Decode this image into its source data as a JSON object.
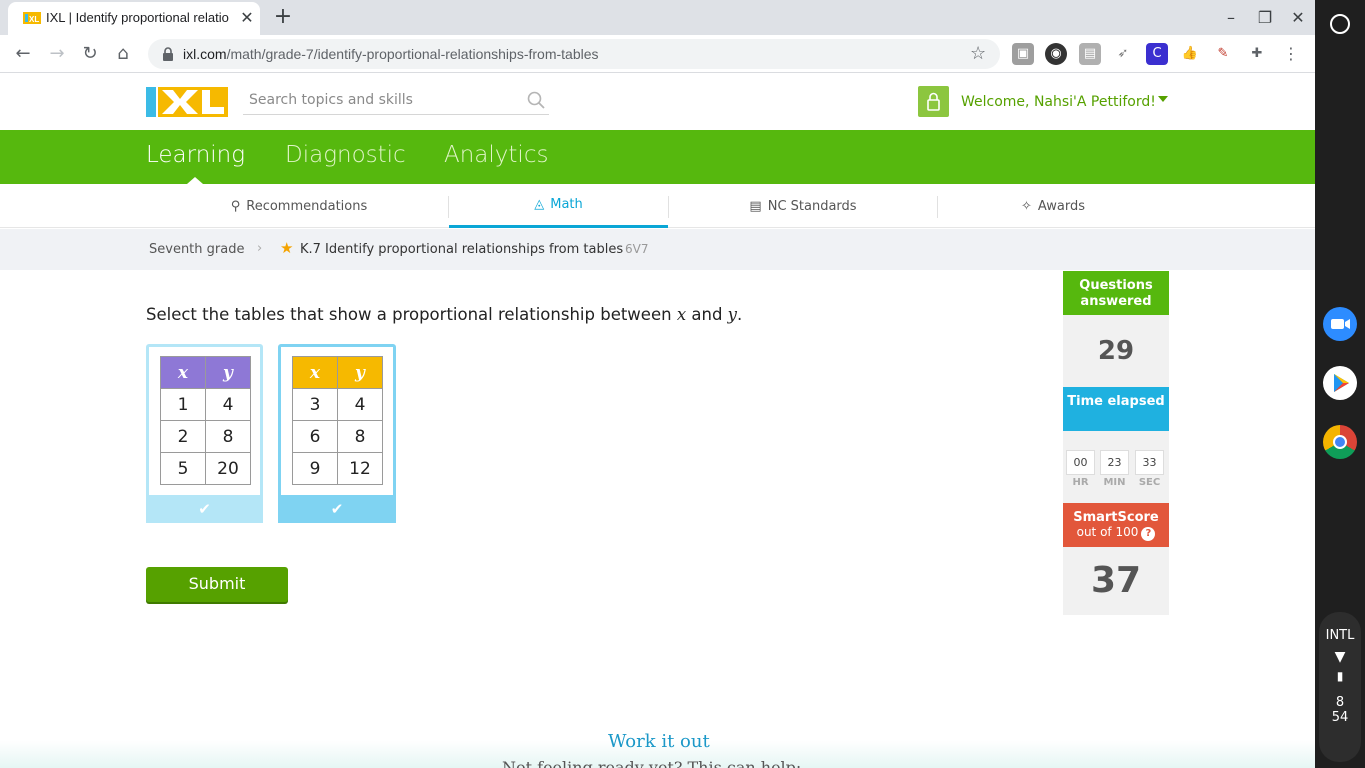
{
  "browser": {
    "tab_title": "IXL | Identify proportional relatio",
    "url_host": "ixl.com",
    "url_path": "/math/grade-7/identify-proportional-relationships-from-tables",
    "new_tab": "+",
    "tab_close": "✕"
  },
  "header": {
    "logo": "IXL",
    "search_placeholder": "Search topics and skills",
    "welcome": "Welcome, Nahsi'A Pettiford!"
  },
  "main_nav": {
    "items": [
      {
        "label": "Learning"
      },
      {
        "label": "Diagnostic"
      },
      {
        "label": "Analytics"
      }
    ]
  },
  "sub_nav": {
    "items": [
      {
        "label": "Recommendations"
      },
      {
        "label": "Math"
      },
      {
        "label": "NC Standards"
      },
      {
        "label": "Awards"
      }
    ]
  },
  "breadcrumb": {
    "grade": "Seventh grade",
    "skill": "K.7 Identify proportional relationships from tables",
    "code": "6V7"
  },
  "question": {
    "prompt_before": "Select the tables that show a proportional relationship between ",
    "var_x": "x",
    "and": " and ",
    "var_y": "y",
    "period": ".",
    "tables": [
      {
        "header": [
          "x",
          "y"
        ],
        "rows": [
          [
            "1",
            "4"
          ],
          [
            "2",
            "8"
          ],
          [
            "5",
            "20"
          ]
        ],
        "header_color": "#8e78d6",
        "selected": false
      },
      {
        "header": [
          "x",
          "y"
        ],
        "rows": [
          [
            "3",
            "4"
          ],
          [
            "6",
            "8"
          ],
          [
            "9",
            "12"
          ]
        ],
        "header_color": "#f6b900",
        "selected": true
      }
    ],
    "check_glyph": "✔",
    "submit": "Submit"
  },
  "stats": {
    "questions_label": "Questions answered",
    "questions_value": "29",
    "time_label": "Time elapsed",
    "time": {
      "hr": "00",
      "min": "23",
      "sec": "33"
    },
    "time_units": {
      "hr": "HR",
      "min": "MIN",
      "sec": "SEC"
    },
    "smartscore_label": "SmartScore",
    "smartscore_sub": "out of 100",
    "smartscore_help": "?",
    "smartscore_value": "37"
  },
  "footer": {
    "work_it_out": "Work it out",
    "not_feeling": "Not feeling ready yet? This can help:"
  },
  "shelf": {
    "ime": "INTL",
    "clock_hour": "8",
    "clock_min": "54"
  },
  "colors": {
    "green": "#56b80e",
    "teal": "#0aa6d6",
    "smartscore": "#e2573b",
    "questions": "#56b80e",
    "time": "#1fb1e0"
  }
}
